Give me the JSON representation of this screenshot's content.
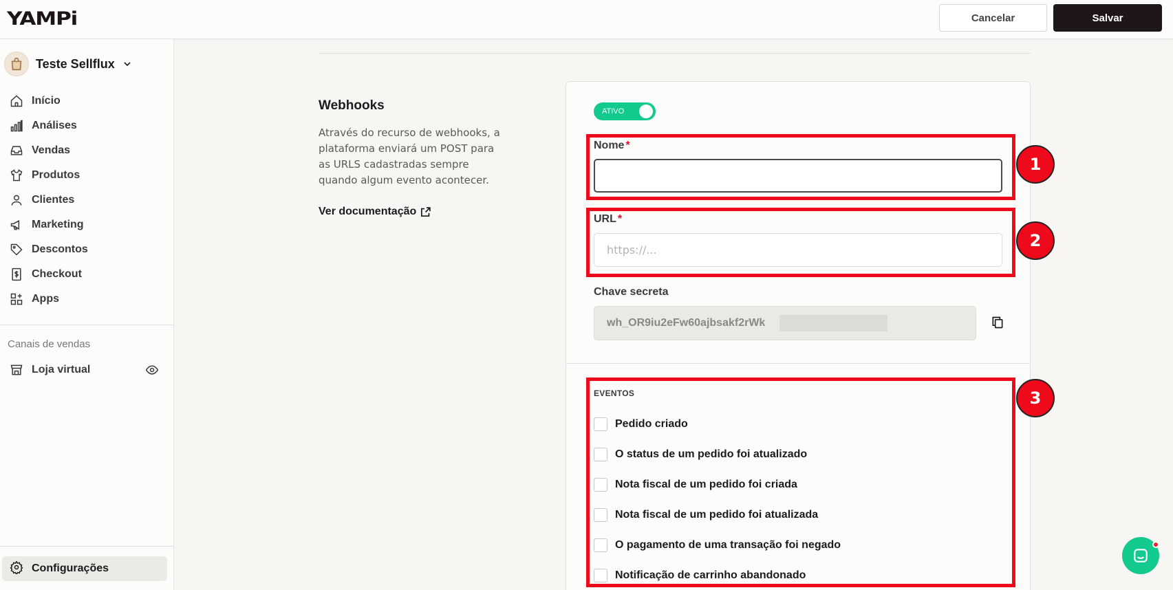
{
  "header": {
    "logo": "YAMPi",
    "cancel_label": "Cancelar",
    "save_label": "Salvar"
  },
  "sidebar": {
    "store_name": "Teste Sellflux",
    "items": [
      {
        "label": "Início",
        "icon": "home-icon"
      },
      {
        "label": "Análises",
        "icon": "bar-chart-icon"
      },
      {
        "label": "Vendas",
        "icon": "inbox-icon"
      },
      {
        "label": "Produtos",
        "icon": "shirt-icon"
      },
      {
        "label": "Clientes",
        "icon": "user-icon"
      },
      {
        "label": "Marketing",
        "icon": "megaphone-icon"
      },
      {
        "label": "Descontos",
        "icon": "tag-icon"
      },
      {
        "label": "Checkout",
        "icon": "receipt-icon"
      },
      {
        "label": "Apps",
        "icon": "apps-grid-icon"
      }
    ],
    "channels_heading": "Canais de vendas",
    "channel_item": "Loja virtual",
    "settings_label": "Configurações"
  },
  "section": {
    "title": "Webhooks",
    "description": "Através do recurso de webhooks, a plataforma enviará um POST para as URLS cadastradas sempre quando algum evento acontecer.",
    "doc_link": "Ver documentação"
  },
  "form": {
    "toggle_label": "ATIVO",
    "name_label": "Nome",
    "required_mark": "*",
    "name_value": "",
    "url_label": "URL",
    "url_placeholder": "https://...",
    "secret_label": "Chave secreta",
    "secret_value": "wh_OR9iu2eFw60ajbsakf2rWk"
  },
  "events": {
    "title": "EVENTOS",
    "items": [
      "Pedido criado",
      "O status de um pedido foi atualizado",
      "Nota fiscal de um pedido foi criada",
      "Nota fiscal de um pedido foi atualizada",
      "O pagamento de uma transação foi negado",
      "Notificação de carrinho abandonado"
    ]
  },
  "annotations": [
    "1",
    "2",
    "3"
  ],
  "colors": {
    "accent_green": "#12c98e",
    "annotation_red": "#ee0a1a",
    "primary_dark": "#1f161a"
  }
}
